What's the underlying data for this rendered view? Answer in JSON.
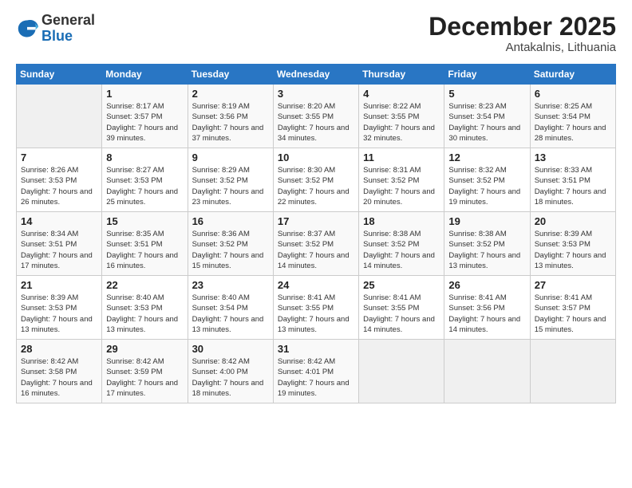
{
  "header": {
    "logo_general": "General",
    "logo_blue": "Blue",
    "month_title": "December 2025",
    "location": "Antakalnis, Lithuania"
  },
  "days_of_week": [
    "Sunday",
    "Monday",
    "Tuesday",
    "Wednesday",
    "Thursday",
    "Friday",
    "Saturday"
  ],
  "weeks": [
    [
      {
        "day": "",
        "sunrise": "",
        "sunset": "",
        "daylight": ""
      },
      {
        "day": "1",
        "sunrise": "Sunrise: 8:17 AM",
        "sunset": "Sunset: 3:57 PM",
        "daylight": "Daylight: 7 hours and 39 minutes."
      },
      {
        "day": "2",
        "sunrise": "Sunrise: 8:19 AM",
        "sunset": "Sunset: 3:56 PM",
        "daylight": "Daylight: 7 hours and 37 minutes."
      },
      {
        "day": "3",
        "sunrise": "Sunrise: 8:20 AM",
        "sunset": "Sunset: 3:55 PM",
        "daylight": "Daylight: 7 hours and 34 minutes."
      },
      {
        "day": "4",
        "sunrise": "Sunrise: 8:22 AM",
        "sunset": "Sunset: 3:55 PM",
        "daylight": "Daylight: 7 hours and 32 minutes."
      },
      {
        "day": "5",
        "sunrise": "Sunrise: 8:23 AM",
        "sunset": "Sunset: 3:54 PM",
        "daylight": "Daylight: 7 hours and 30 minutes."
      },
      {
        "day": "6",
        "sunrise": "Sunrise: 8:25 AM",
        "sunset": "Sunset: 3:54 PM",
        "daylight": "Daylight: 7 hours and 28 minutes."
      }
    ],
    [
      {
        "day": "7",
        "sunrise": "Sunrise: 8:26 AM",
        "sunset": "Sunset: 3:53 PM",
        "daylight": "Daylight: 7 hours and 26 minutes."
      },
      {
        "day": "8",
        "sunrise": "Sunrise: 8:27 AM",
        "sunset": "Sunset: 3:53 PM",
        "daylight": "Daylight: 7 hours and 25 minutes."
      },
      {
        "day": "9",
        "sunrise": "Sunrise: 8:29 AM",
        "sunset": "Sunset: 3:52 PM",
        "daylight": "Daylight: 7 hours and 23 minutes."
      },
      {
        "day": "10",
        "sunrise": "Sunrise: 8:30 AM",
        "sunset": "Sunset: 3:52 PM",
        "daylight": "Daylight: 7 hours and 22 minutes."
      },
      {
        "day": "11",
        "sunrise": "Sunrise: 8:31 AM",
        "sunset": "Sunset: 3:52 PM",
        "daylight": "Daylight: 7 hours and 20 minutes."
      },
      {
        "day": "12",
        "sunrise": "Sunrise: 8:32 AM",
        "sunset": "Sunset: 3:52 PM",
        "daylight": "Daylight: 7 hours and 19 minutes."
      },
      {
        "day": "13",
        "sunrise": "Sunrise: 8:33 AM",
        "sunset": "Sunset: 3:51 PM",
        "daylight": "Daylight: 7 hours and 18 minutes."
      }
    ],
    [
      {
        "day": "14",
        "sunrise": "Sunrise: 8:34 AM",
        "sunset": "Sunset: 3:51 PM",
        "daylight": "Daylight: 7 hours and 17 minutes."
      },
      {
        "day": "15",
        "sunrise": "Sunrise: 8:35 AM",
        "sunset": "Sunset: 3:51 PM",
        "daylight": "Daylight: 7 hours and 16 minutes."
      },
      {
        "day": "16",
        "sunrise": "Sunrise: 8:36 AM",
        "sunset": "Sunset: 3:52 PM",
        "daylight": "Daylight: 7 hours and 15 minutes."
      },
      {
        "day": "17",
        "sunrise": "Sunrise: 8:37 AM",
        "sunset": "Sunset: 3:52 PM",
        "daylight": "Daylight: 7 hours and 14 minutes."
      },
      {
        "day": "18",
        "sunrise": "Sunrise: 8:38 AM",
        "sunset": "Sunset: 3:52 PM",
        "daylight": "Daylight: 7 hours and 14 minutes."
      },
      {
        "day": "19",
        "sunrise": "Sunrise: 8:38 AM",
        "sunset": "Sunset: 3:52 PM",
        "daylight": "Daylight: 7 hours and 13 minutes."
      },
      {
        "day": "20",
        "sunrise": "Sunrise: 8:39 AM",
        "sunset": "Sunset: 3:53 PM",
        "daylight": "Daylight: 7 hours and 13 minutes."
      }
    ],
    [
      {
        "day": "21",
        "sunrise": "Sunrise: 8:39 AM",
        "sunset": "Sunset: 3:53 PM",
        "daylight": "Daylight: 7 hours and 13 minutes."
      },
      {
        "day": "22",
        "sunrise": "Sunrise: 8:40 AM",
        "sunset": "Sunset: 3:53 PM",
        "daylight": "Daylight: 7 hours and 13 minutes."
      },
      {
        "day": "23",
        "sunrise": "Sunrise: 8:40 AM",
        "sunset": "Sunset: 3:54 PM",
        "daylight": "Daylight: 7 hours and 13 minutes."
      },
      {
        "day": "24",
        "sunrise": "Sunrise: 8:41 AM",
        "sunset": "Sunset: 3:55 PM",
        "daylight": "Daylight: 7 hours and 13 minutes."
      },
      {
        "day": "25",
        "sunrise": "Sunrise: 8:41 AM",
        "sunset": "Sunset: 3:55 PM",
        "daylight": "Daylight: 7 hours and 14 minutes."
      },
      {
        "day": "26",
        "sunrise": "Sunrise: 8:41 AM",
        "sunset": "Sunset: 3:56 PM",
        "daylight": "Daylight: 7 hours and 14 minutes."
      },
      {
        "day": "27",
        "sunrise": "Sunrise: 8:41 AM",
        "sunset": "Sunset: 3:57 PM",
        "daylight": "Daylight: 7 hours and 15 minutes."
      }
    ],
    [
      {
        "day": "28",
        "sunrise": "Sunrise: 8:42 AM",
        "sunset": "Sunset: 3:58 PM",
        "daylight": "Daylight: 7 hours and 16 minutes."
      },
      {
        "day": "29",
        "sunrise": "Sunrise: 8:42 AM",
        "sunset": "Sunset: 3:59 PM",
        "daylight": "Daylight: 7 hours and 17 minutes."
      },
      {
        "day": "30",
        "sunrise": "Sunrise: 8:42 AM",
        "sunset": "Sunset: 4:00 PM",
        "daylight": "Daylight: 7 hours and 18 minutes."
      },
      {
        "day": "31",
        "sunrise": "Sunrise: 8:42 AM",
        "sunset": "Sunset: 4:01 PM",
        "daylight": "Daylight: 7 hours and 19 minutes."
      },
      {
        "day": "",
        "sunrise": "",
        "sunset": "",
        "daylight": ""
      },
      {
        "day": "",
        "sunrise": "",
        "sunset": "",
        "daylight": ""
      },
      {
        "day": "",
        "sunrise": "",
        "sunset": "",
        "daylight": ""
      }
    ]
  ]
}
